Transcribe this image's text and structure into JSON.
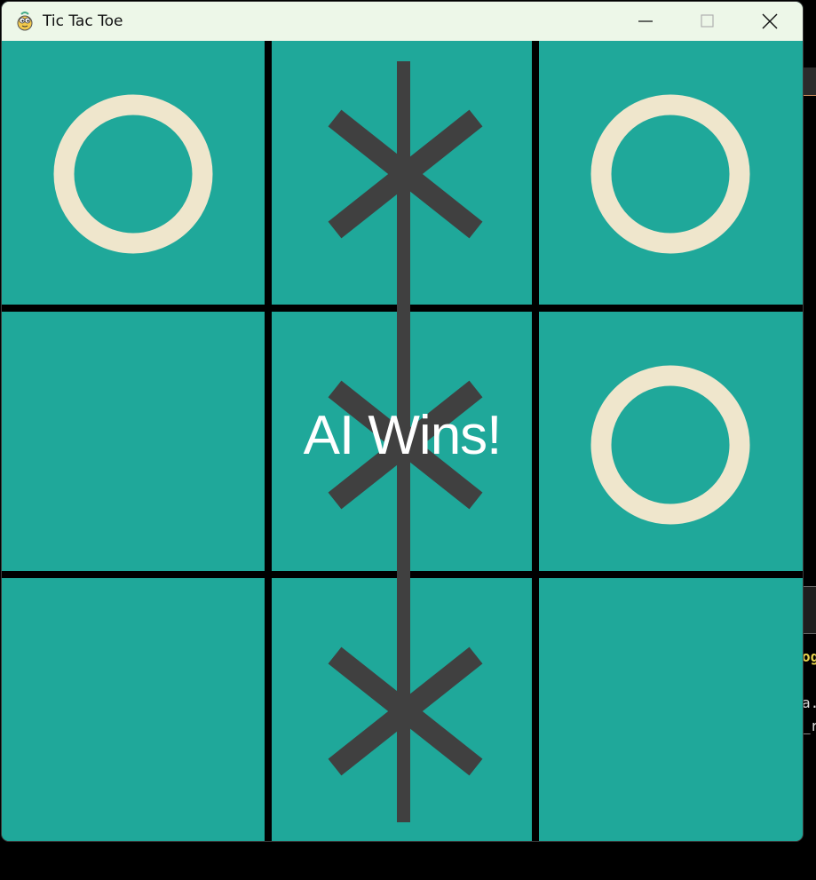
{
  "window": {
    "title": "Tic Tac Toe",
    "controls": [
      "minimize",
      "maximize",
      "close"
    ]
  },
  "theme": {
    "board_color": "#1fa89a",
    "grid_color": "#000000",
    "x_color": "#404040",
    "o_color": "#efe6cc",
    "titlebar_color": "#edf7e8",
    "status_color": "#ffffff"
  },
  "board": {
    "cells": [
      [
        "O",
        "X",
        "O"
      ],
      [
        "",
        "X",
        "O"
      ],
      [
        "",
        "X",
        ""
      ]
    ],
    "winning_line": "column-2"
  },
  "status": {
    "message": "AI Wins!"
  },
  "background_fragments": [
    "og",
    "a.",
    "_r"
  ]
}
